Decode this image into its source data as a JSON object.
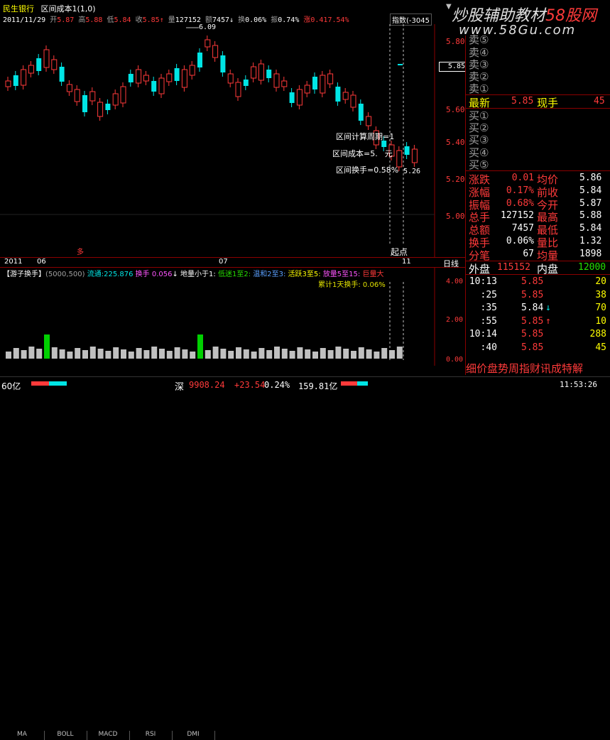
{
  "header": {
    "stock_name": "民生银行",
    "indicator": "区间成本1(1,0)",
    "date": "2011/11/29",
    "open_label": "开",
    "open_val": "5.87",
    "high_label": "高",
    "high_val": "5.88",
    "low_label": "低",
    "low_val": "5.84",
    "close_label": "收",
    "close_val": "5.85",
    "vol_label": "量",
    "vol_val": "127152",
    "amount_label": "额",
    "amount_val": "7457",
    "turnover_label": "换",
    "turnover_val": "0.06%",
    "amp_label": "振",
    "amp_val": "0.74%",
    "chg_label": "涨",
    "chg_val": "0.41",
    "chg_pct": "7.54%",
    "index_label": "指数",
    "index_val": "(-3045",
    "watermark1": "炒股辅助教材",
    "watermark2": "58股网",
    "watermark_url": "www.58Gu.com"
  },
  "chart": {
    "high_mark": "6.09",
    "low_mark": "5.26",
    "annot_period": "区间计算周期=1",
    "annot_cost": "区间成本=5.",
    "annot_cost_suffix": "元",
    "annot_turn": "区间换手=0.58%",
    "start_label": "起点",
    "price_axis": [
      "5.80",
      "5.60",
      "5.40",
      "5.20",
      "5.00"
    ],
    "current_price_tag": "5.85",
    "x_labels": [
      "2011",
      "06",
      "07",
      "11"
    ],
    "period_label": "日线",
    "red_mark": "多"
  },
  "lower": {
    "title": "【游子换手】",
    "params": "(5000,500)",
    "float_label": "流通:",
    "float_val": "225.876",
    "turnover_label": "换手",
    "turnover_val": "0.056",
    "vol_label": "地量小于1:",
    "low_label": "低迷1至2:",
    "mild_label": "温和2至3:",
    "active_label": "活跃3至5:",
    "heavy_label": "放量5至15:",
    "huge_label": "巨量大",
    "cum_label": "累计1天换手:",
    "cum_val": "0.06%",
    "axis": [
      "4.00",
      "2.00",
      "0.00"
    ]
  },
  "tabs": [
    "MA",
    "BOLL",
    "MACD",
    "RSI",
    "DMI"
  ],
  "side": {
    "sell": [
      "卖⑤",
      "卖④",
      "卖③",
      "卖②",
      "卖①"
    ],
    "latest_label": "最新",
    "latest_val": "5.85",
    "now_label": "现手",
    "now_val": "45",
    "buy": [
      "买①",
      "买②",
      "买③",
      "买④",
      "买⑤"
    ],
    "stats": [
      {
        "l1": "涨跌",
        "v1": "0.01",
        "l2": "均价",
        "v2": "5.86"
      },
      {
        "l1": "涨幅",
        "v1": "0.17%",
        "l2": "前收",
        "v2": "5.84"
      },
      {
        "l1": "振幅",
        "v1": "0.68%",
        "l2": "今开",
        "v2": "5.87"
      },
      {
        "l1": "总手",
        "v1": "127152",
        "l2": "最高",
        "v2": "5.88"
      },
      {
        "l1": "总额",
        "v1": "7457",
        "l2": "最低",
        "v2": "5.84"
      },
      {
        "l1": "换手",
        "v1": "0.06%",
        "l2": "量比",
        "v2": "1.32"
      },
      {
        "l1": "分笔",
        "v1": "67",
        "l2": "均量",
        "v2": "1898"
      }
    ],
    "outer_label": "外盘",
    "outer_val": "115152",
    "inner_label": "内盘",
    "inner_val": "12000",
    "ticks": [
      {
        "t": "10:13",
        "p": "5.85",
        "v": "20"
      },
      {
        "t": ":25",
        "p": "5.85",
        "v": "38"
      },
      {
        "t": ":35",
        "p": "5.84",
        "v": "70"
      },
      {
        "t": ":55",
        "p": "5.85",
        "v": "10"
      },
      {
        "t": "10:14",
        "p": "5.85",
        "v": "288"
      },
      {
        "t": ":40",
        "p": "5.85",
        "v": "45"
      }
    ],
    "bottom_tabs": "细价盘势周指财讯成特解"
  },
  "footer": {
    "left": "60亿",
    "market": "深",
    "index_val": "9908.24",
    "index_chg": "+23.54",
    "index_pct": "0.24%",
    "turnover": "159.81亿",
    "time": "11:53:26"
  }
}
